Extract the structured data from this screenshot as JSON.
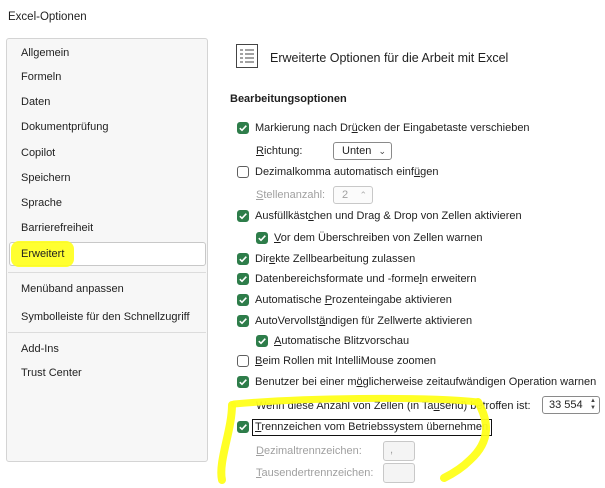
{
  "window": {
    "title": "Excel-Optionen"
  },
  "sidebar": {
    "items": [
      {
        "label": "Allgemein"
      },
      {
        "label": "Formeln"
      },
      {
        "label": "Daten"
      },
      {
        "label": "Dokumentprüfung"
      },
      {
        "label": "Copilot"
      },
      {
        "label": "Speichern"
      },
      {
        "label": "Sprache"
      },
      {
        "label": "Barrierefreiheit"
      },
      {
        "label": "Erweitert",
        "selected": true
      },
      {
        "label": "Menüband anpassen"
      },
      {
        "label": "Symbolleiste für den Schnellzugriff"
      },
      {
        "label": "Add-Ins"
      },
      {
        "label": "Trust Center"
      }
    ]
  },
  "main": {
    "heading": "Erweiterte Optionen für die Arbeit mit Excel",
    "heading_icon": "advanced-options-icon",
    "section": "Bearbeitungsoptionen",
    "options": {
      "markierung": {
        "pre": "Markierung nach Dr",
        "u": "ü",
        "post": "cken der Eingabetaste verschieben",
        "checked": true
      },
      "richtung": {
        "pre": "",
        "u": "R",
        "post": "ichtung:",
        "value": "Unten"
      },
      "dezimalkomma": {
        "pre": "Dezimalkomma automatisch einf",
        "u": "ü",
        "post": "gen",
        "checked": false
      },
      "stellenanzahl": {
        "pre": "",
        "u": "S",
        "post": "tellenanzahl:",
        "value": "2"
      },
      "ausfuell": {
        "pre": "Ausfüllkäst",
        "u": "c",
        "post": "hen und Drag & Drop von Zellen aktivieren",
        "checked": true
      },
      "ueberschreiben": {
        "pre": "",
        "u": "V",
        "post": "or dem Überschreiben von Zellen warnen",
        "checked": true
      },
      "direkt": {
        "pre": "Dir",
        "u": "e",
        "post": "kte Zellbearbeitung zulassen",
        "checked": true
      },
      "datenbereich": {
        "pre": "Datenbereichsformate und -forme",
        "u": "l",
        "post": "n erweitern",
        "checked": true
      },
      "prozent": {
        "pre": "Automatische ",
        "u": "P",
        "post": "rozenteingabe aktivieren",
        "checked": true
      },
      "autoverv": {
        "pre": "AutoVervollst",
        "u": "ä",
        "post": "ndigen für Zellwerte aktivieren",
        "checked": true
      },
      "blitz": {
        "pre": "",
        "u": "A",
        "post": "utomatische Blitzvorschau",
        "checked": true
      },
      "rollen": {
        "pre": "",
        "u": "B",
        "post": "eim Rollen mit IntelliMouse zoomen",
        "checked": false
      },
      "warnen": {
        "pre": "Benutzer bei einer m",
        "u": "ö",
        "post": "glicherweise zeitaufwändigen Operation warnen",
        "checked": true
      },
      "anzahl": {
        "pre": "Wenn diese Anzahl von Zellen (in Ta",
        "u": "u",
        "post": "send) betroffen ist:",
        "value": "33 554"
      },
      "trenn": {
        "pre": "",
        "u": "T",
        "post": "rennzeichen vom Betriebssystem übernehmen",
        "checked": true
      },
      "dezimaltrenn": {
        "pre": "",
        "u": "D",
        "post": "ezimaltrennzeichen:",
        "value": ","
      },
      "tausender": {
        "pre": "",
        "u": "T",
        "post": "ausendertrennzeichen:",
        "value": ""
      }
    }
  },
  "colors": {
    "checkbox": "#2e7d4a",
    "highlight": "#ffff1a"
  }
}
